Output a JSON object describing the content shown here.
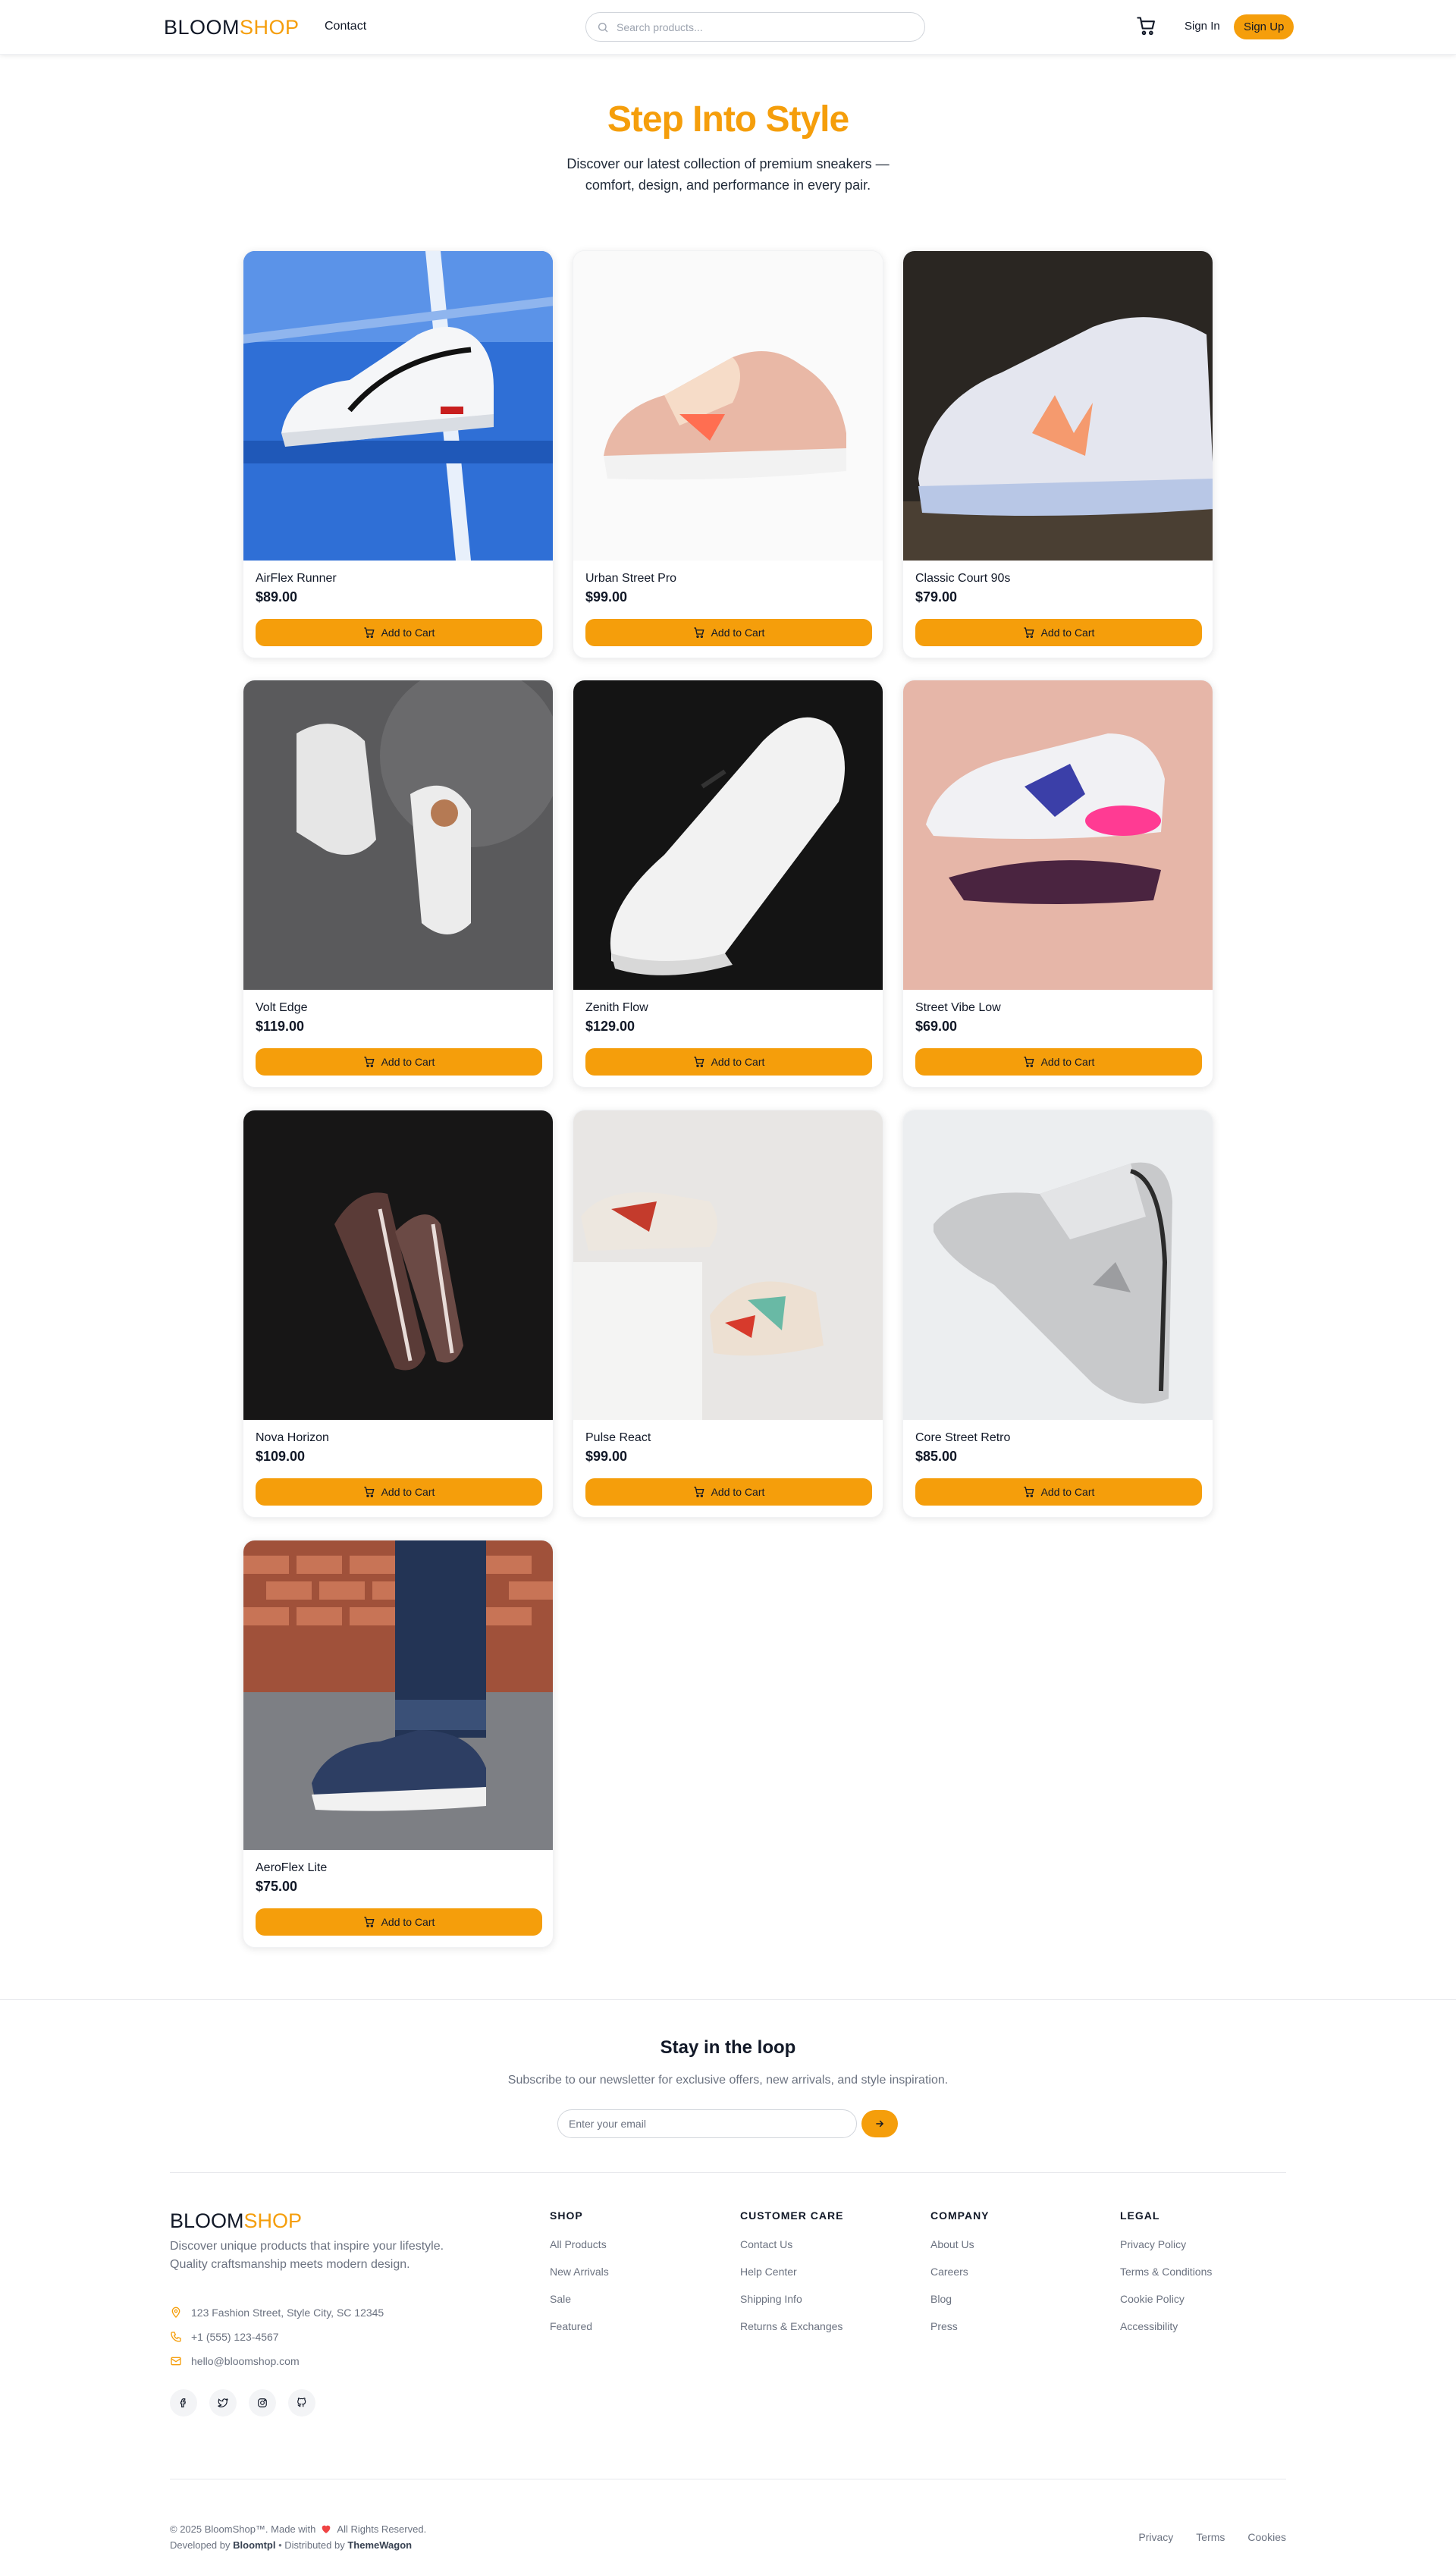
{
  "header": {
    "logo_a": "BLOOM",
    "logo_b": "SHOP",
    "nav_contact": "Contact",
    "search_placeholder": "Search products...",
    "signin": "Sign In",
    "signup": "Sign Up"
  },
  "hero": {
    "title": "Step Into Style",
    "subtitle": "Discover our latest collection of premium sneakers — comfort, design, and performance in every pair."
  },
  "add_label": "Add to Cart",
  "products": [
    {
      "name": "AirFlex Runner",
      "price": "$89.00"
    },
    {
      "name": "Urban Street Pro",
      "price": "$99.00"
    },
    {
      "name": "Classic Court 90s",
      "price": "$79.00"
    },
    {
      "name": "Volt Edge",
      "price": "$119.00"
    },
    {
      "name": "Zenith Flow",
      "price": "$129.00"
    },
    {
      "name": "Street Vibe Low",
      "price": "$69.00"
    },
    {
      "name": "Nova Horizon",
      "price": "$109.00"
    },
    {
      "name": "Pulse React",
      "price": "$99.00"
    },
    {
      "name": "Core Street Retro",
      "price": "$85.00"
    },
    {
      "name": "AeroFlex Lite",
      "price": "$75.00"
    }
  ],
  "newsletter": {
    "title": "Stay in the loop",
    "subtitle": "Subscribe to our newsletter for exclusive offers, new arrivals, and style inspiration.",
    "placeholder": "Enter your email"
  },
  "footer": {
    "logo_a": "BLOOM",
    "logo_b": "SHOP",
    "description": "Discover unique products that inspire your lifestyle. Quality craftsmanship meets modern design.",
    "address": "123 Fashion Street, Style City, SC 12345",
    "phone": "+1 (555) 123-4567",
    "email": "hello@bloomshop.com",
    "columns": [
      {
        "title": "SHOP",
        "links": [
          "All Products",
          "New Arrivals",
          "Sale",
          "Featured"
        ]
      },
      {
        "title": "CUSTOMER CARE",
        "links": [
          "Contact Us",
          "Help Center",
          "Shipping Info",
          "Returns & Exchanges"
        ]
      },
      {
        "title": "COMPANY",
        "links": [
          "About Us",
          "Careers",
          "Blog",
          "Press"
        ]
      },
      {
        "title": "LEGAL",
        "links": [
          "Privacy Policy",
          "Terms & Conditions",
          "Cookie Policy",
          "Accessibility"
        ]
      }
    ],
    "copyright_a": "© 2025 BloomShop™. Made with",
    "copyright_b": "All Rights Reserved.",
    "developed_a": "Developed by",
    "developer": "Bloomtpl",
    "distributed_a": "• Distributed by",
    "distributor": "ThemeWagon",
    "bottom_links": [
      "Privacy",
      "Terms",
      "Cookies"
    ]
  },
  "colors": {
    "accent": "#f59e0b",
    "text": "#111827",
    "muted": "#6b7280"
  }
}
